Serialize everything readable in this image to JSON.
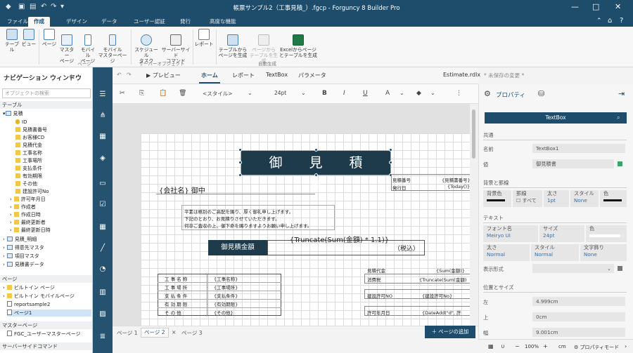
{
  "window": {
    "title": "帳票サンプル2（工事見積_）.fgcp - Forguncy 8 Builder Pro"
  },
  "ribbon": {
    "tabs": [
      "ファイル",
      "作成",
      "デザイン",
      "データ",
      "ユーザー認証",
      "発行",
      "高度な機能"
    ],
    "active_tab": "作成",
    "buttons": [
      {
        "label": "テーブル",
        "icon": "table-add-icon"
      },
      {
        "label": "ビュー",
        "icon": "view-add-icon"
      },
      {
        "label": "ページ",
        "icon": "page-icon"
      },
      {
        "label": "マスター\nページ",
        "icon": "master-page-icon"
      },
      {
        "label": "モバイル\nページ",
        "icon": "mobile-page-icon"
      },
      {
        "label": "モバイル\nマスターページ",
        "icon": "mobile-master-icon"
      },
      {
        "label": "スケジュール\nタスク",
        "icon": "schedule-task-icon"
      },
      {
        "label": "サーバーサイド\nコマンド",
        "icon": "server-command-icon"
      },
      {
        "label": "レポート",
        "icon": "report-icon"
      },
      {
        "label": "テーブルから\nページを生成",
        "icon": "table-to-page-icon"
      },
      {
        "label": "ページから\nテーブルを生成",
        "icon": "page-to-table-icon",
        "disabled": true
      },
      {
        "label": "Excelからページ\nとテーブルを生成",
        "icon": "excel-icon"
      }
    ],
    "groups": [
      "ページ",
      "サーバーオブジェクト",
      "自動生成"
    ]
  },
  "nav": {
    "title": "ナビゲーション ウィンドウ",
    "search_placeholder": "オブジェクトの検索",
    "sections": {
      "table": "テーブル",
      "page": "ページ",
      "master": "マスターページ",
      "server": "サーバーサイドコマンド"
    },
    "table_items": [
      "見積",
      "ID",
      "見積書番号",
      "お客様CD",
      "見積代金",
      "工事名称",
      "工事場所",
      "支払条件",
      "有効期限",
      "その他",
      "建設許可No",
      "許可年月日",
      "作成者",
      "作成日時",
      "最終更新者",
      "最終更新日時",
      "見積_明細",
      "得意先マスタ",
      "項目マスタ",
      "見積書データ"
    ],
    "page_items": [
      "ビルトイン ページ",
      "ビルトイン モバイルページ",
      "reportsample2",
      "ページ1"
    ],
    "master_items": [
      "FGC_ユーザーマスターページ"
    ]
  },
  "center_tabs": {
    "preview": "プレビュー",
    "tabs": [
      "ホーム",
      "レポート",
      "TextBox",
      "パラメータ"
    ],
    "active": "ホーム",
    "file": "Estimate.rdlx",
    "unsaved": "* 未保存の変更 *"
  },
  "toolbar": {
    "style": "<スタイル>",
    "font_size": "24pt"
  },
  "report": {
    "title": "御 見 積 書",
    "company": "{会社名} 御中",
    "greeting": [
      "平素は格別のご高配を賜り、厚く御礼申し上げます。",
      "下記のとおり、お見積りさせていただきます。",
      "何卒ご査収の上、御下命を賜りますようお願い申し上げます。"
    ],
    "amount_label": "御見積金額",
    "amount_expr": "{Truncate(Sum(金額) * 1.1)}",
    "tax_incl": "（税込）",
    "info_rows": [
      {
        "label": "見積番号",
        "value": "{見積書番号}"
      },
      {
        "label": "発行日",
        "value": "{Today()}"
      }
    ],
    "subtotal_label": "見積代金",
    "subtotal_value": "{Sum(金額)}",
    "tax_label": "消費税",
    "tax_value": "{Truncate(Sum(金額)",
    "license_label": "建設許可NO",
    "license_value": "{建設許可No}",
    "permit_label": "許可年月日",
    "permit_value": "{DateAdd(\"d\", 許",
    "detail_rows": [
      {
        "label": "工 事 名 称",
        "value": "{工事名称}"
      },
      {
        "label": "工 事 場 所",
        "value": "{工事場所}"
      },
      {
        "label": "支 払 条 件",
        "value": "{支払条件}"
      },
      {
        "label": "有 効 期 限",
        "value": "{有効期限}"
      },
      {
        "label": "そ の 他",
        "value": "{その他}"
      }
    ]
  },
  "page_tabs": {
    "tabs": [
      "ページ 1",
      "ページ 2",
      "ページ 3"
    ],
    "active": "ページ 2",
    "add_label": "ページの追加"
  },
  "props": {
    "header": "プロパティ",
    "component": "TextBox",
    "common": "共通",
    "name_label": "名前",
    "name_value": "TextBox1",
    "value_label": "値",
    "value_value": "御見積書",
    "bg_section": "背景と罫線",
    "bg_color": "背景色",
    "border": "罫線",
    "width": "太さ",
    "style": "スタイル",
    "color": "色",
    "all": "すべて",
    "width_value": "1pt",
    "style_value": "None",
    "text_section": "テキスト",
    "font_name": "フォント名",
    "font_name_value": "Meiryo UI",
    "size_label": "サイズ",
    "size_value": "24pt",
    "color_label": "色",
    "weight_label": "太さ",
    "weight_value": "Normal",
    "style_label": "スタイル",
    "style_label_value": "Normal",
    "decor_label": "文字飾り",
    "decor_value": "None",
    "format_label": "表示形式",
    "pos_section": "位置とサイズ",
    "left_label": "左",
    "left_value": "4.999cm",
    "top_label": "上",
    "top_value": "0cm",
    "wid_label": "幅",
    "wid_value": "9.001cm"
  },
  "status": {
    "zoom": "100%",
    "unit": "cm",
    "mode": "プロパティモード"
  }
}
